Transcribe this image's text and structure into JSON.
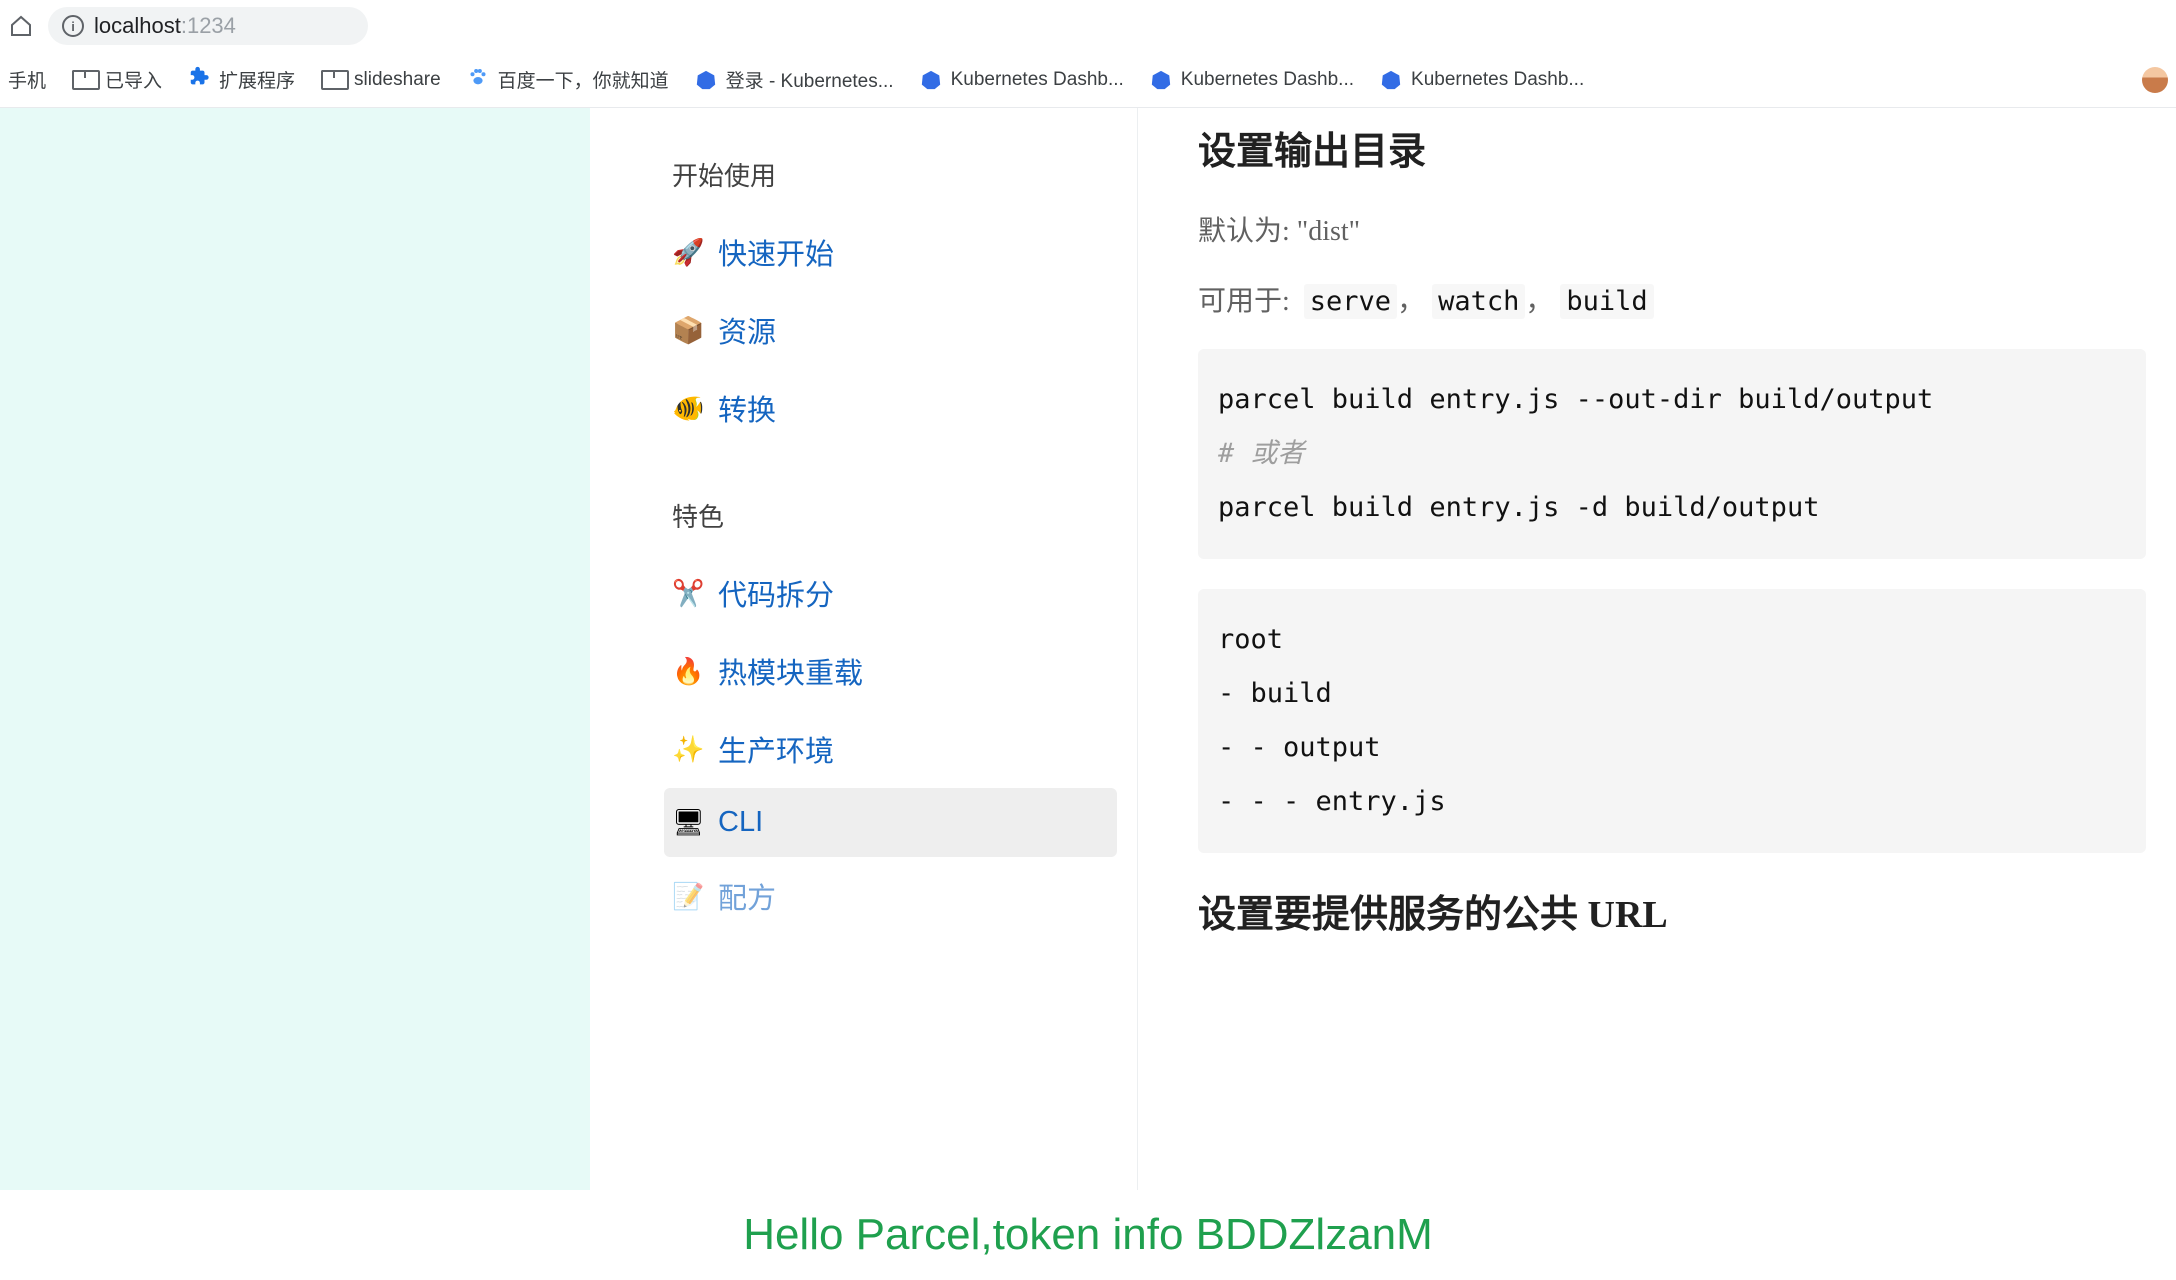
{
  "browser": {
    "url_host": "localhost",
    "url_port": ":1234",
    "bookmarks": [
      {
        "icon": "text",
        "label": "手机"
      },
      {
        "icon": "folder",
        "label": "已导入"
      },
      {
        "icon": "ext",
        "label": "扩展程序"
      },
      {
        "icon": "folder",
        "label": "slideshare"
      },
      {
        "icon": "paw",
        "label": "百度一下，你就知道"
      },
      {
        "icon": "k8s",
        "label": "登录 - Kubernetes..."
      },
      {
        "icon": "k8s",
        "label": "Kubernetes Dashb..."
      },
      {
        "icon": "k8s",
        "label": "Kubernetes Dashb..."
      },
      {
        "icon": "k8s",
        "label": "Kubernetes Dashb..."
      }
    ]
  },
  "sidebar": {
    "groups": [
      {
        "heading": "开始使用",
        "items": [
          {
            "emoji": "🚀",
            "label": "快速开始",
            "active": false
          },
          {
            "emoji": "📦",
            "label": "资源",
            "active": false
          },
          {
            "emoji": "🐠",
            "label": "转换",
            "active": false
          }
        ]
      },
      {
        "heading": "特色",
        "items": [
          {
            "emoji": "✂️",
            "label": "代码拆分",
            "active": false
          },
          {
            "emoji": "🔥",
            "label": "热模块重载",
            "active": false
          },
          {
            "emoji": "✨",
            "label": "生产环境",
            "active": false
          },
          {
            "emoji": "🖥",
            "label": "CLI",
            "active": true
          },
          {
            "emoji": "📝",
            "label": "配方",
            "active": false
          }
        ]
      }
    ]
  },
  "content": {
    "h2_1": "设置输出目录",
    "default_prefix": "默认为:",
    "default_value": "\"dist\"",
    "usable_prefix": "可用于:",
    "usable_cmds": [
      "serve",
      "watch",
      "build"
    ],
    "code1_line1": "parcel build entry.js --out-dir build/output",
    "code1_comment": "# 或者",
    "code1_line2": "parcel build entry.js -d build/output",
    "code2_line1": "root",
    "code2_line2": "- build",
    "code2_line3": "- - output",
    "code2_line4": "- - - entry.js",
    "h2_2": "设置要提供服务的公共 URL"
  },
  "overlay": {
    "text": "Hello Parcel,token info BDDZlzanM"
  },
  "sep": "，"
}
